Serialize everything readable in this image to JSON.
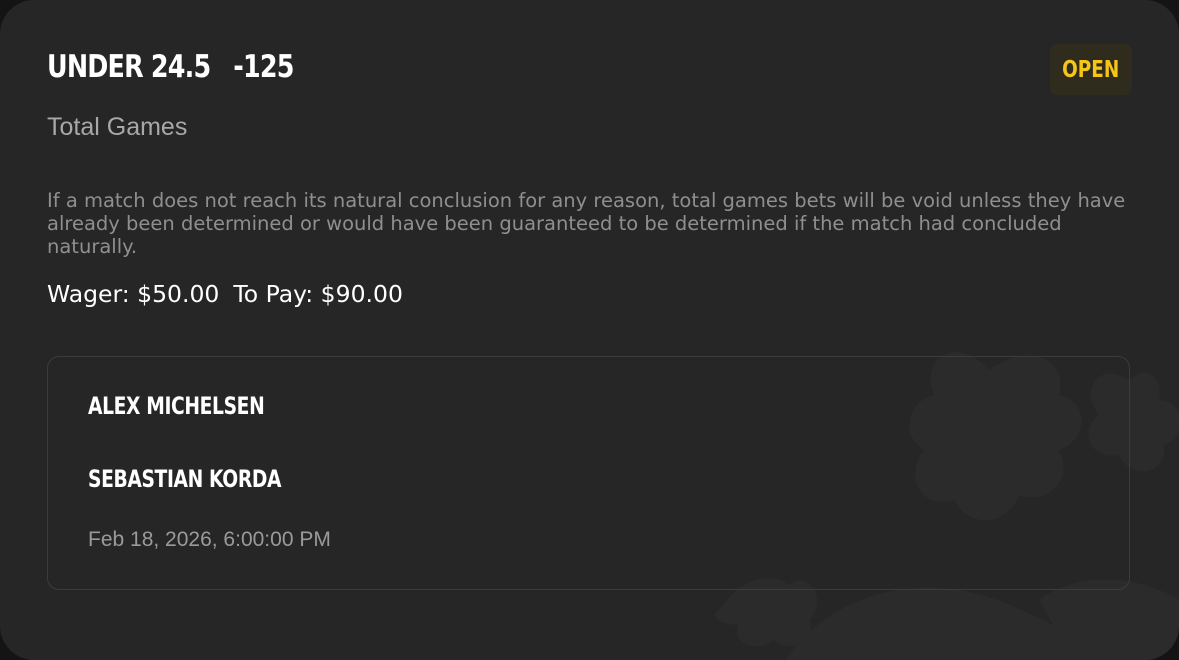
{
  "bet": {
    "selection": "UNDER 24.5",
    "odds": "-125",
    "status": "OPEN",
    "market": "Total Games",
    "rule": "If a match does not reach its natural conclusion for any reason, total games bets will be void unless they have already been determined or would have been guaranteed to be determined if the match had concluded naturally.",
    "wager": "Wager: $50.00",
    "to_pay": "To Pay: $90.00"
  },
  "match": {
    "player1": "ALEX MICHELSEN",
    "player2": "SEBASTIAN KORDA",
    "datetime": "Feb 18, 2026, 6:00:00 PM"
  },
  "colors": {
    "background": "#262626",
    "status_text": "#f5c518",
    "status_bg": "#2f2c1d",
    "muted_text": "#a8a8a8"
  },
  "icons": {
    "watermark": "brand-crown-watermark-icon"
  }
}
